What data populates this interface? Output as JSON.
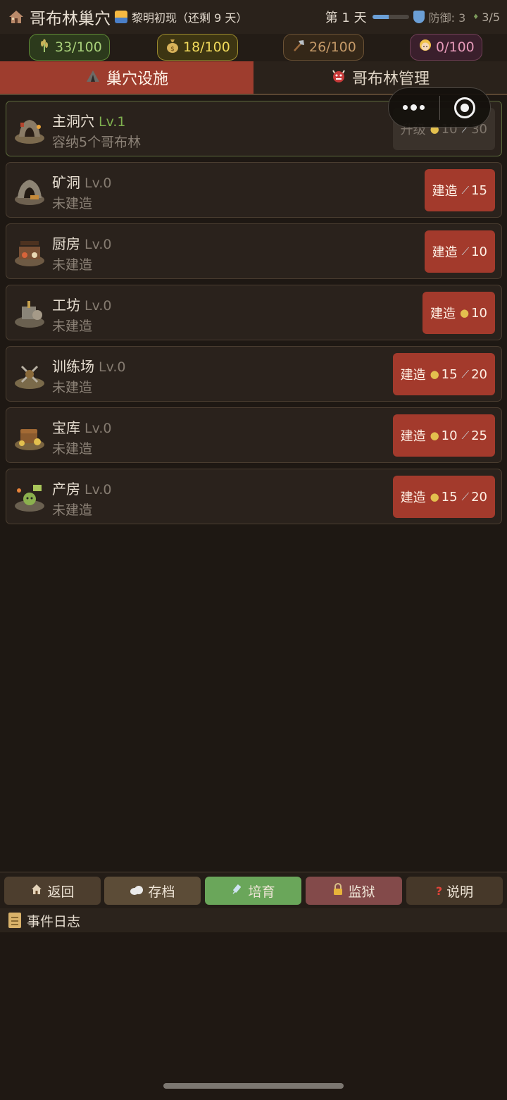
{
  "header": {
    "title": "哥布林巢穴",
    "phase": "黎明初现（还剩 9 天）",
    "day": "第 1 天",
    "day_progress": 0.45,
    "defense": "防御: 3",
    "population": "3/5"
  },
  "resources": {
    "grain": "33/100",
    "gold": "18/100",
    "tools": "26/100",
    "captives": "0/100"
  },
  "tabs": [
    {
      "label": "巢穴设施",
      "active": true
    },
    {
      "label": "哥布林管理",
      "active": false
    }
  ],
  "buildings": [
    {
      "name": "主洞穴",
      "level": "Lv.1",
      "desc": "容纳5个哥布林",
      "action": "升级",
      "costs": [
        {
          "icon": "money-bag-icon",
          "value": "10"
        },
        {
          "icon": "axe-icon",
          "value": "30"
        }
      ],
      "disabled": true
    },
    {
      "name": "矿洞",
      "level": "Lv.0",
      "desc": "未建造",
      "action": "建造",
      "costs": [
        {
          "icon": "axe-icon",
          "value": "15"
        }
      ]
    },
    {
      "name": "厨房",
      "level": "Lv.0",
      "desc": "未建造",
      "action": "建造",
      "costs": [
        {
          "icon": "axe-icon",
          "value": "10"
        }
      ]
    },
    {
      "name": "工坊",
      "level": "Lv.0",
      "desc": "未建造",
      "action": "建造",
      "costs": [
        {
          "icon": "money-bag-icon",
          "value": "10"
        }
      ]
    },
    {
      "name": "训练场",
      "level": "Lv.0",
      "desc": "未建造",
      "action": "建造",
      "costs": [
        {
          "icon": "money-bag-icon",
          "value": "15"
        },
        {
          "icon": "axe-icon",
          "value": "20"
        }
      ]
    },
    {
      "name": "宝库",
      "level": "Lv.0",
      "desc": "未建造",
      "action": "建造",
      "costs": [
        {
          "icon": "money-bag-icon",
          "value": "10"
        },
        {
          "icon": "axe-icon",
          "value": "25"
        }
      ]
    },
    {
      "name": "产房",
      "level": "Lv.0",
      "desc": "未建造",
      "action": "建造",
      "costs": [
        {
          "icon": "money-bag-icon",
          "value": "15"
        },
        {
          "icon": "axe-icon",
          "value": "20"
        }
      ]
    }
  ],
  "actions": {
    "back": "返回",
    "save": "存档",
    "breed": "培育",
    "prison": "监狱",
    "help": "说明"
  },
  "log": {
    "title": "事件日志"
  },
  "colors": {
    "accent": "#9e3d2e",
    "build_button": "#a33a2c",
    "breed_button": "#6aa65a",
    "prison_button": "#834a4a",
    "background": "#1e1813"
  }
}
